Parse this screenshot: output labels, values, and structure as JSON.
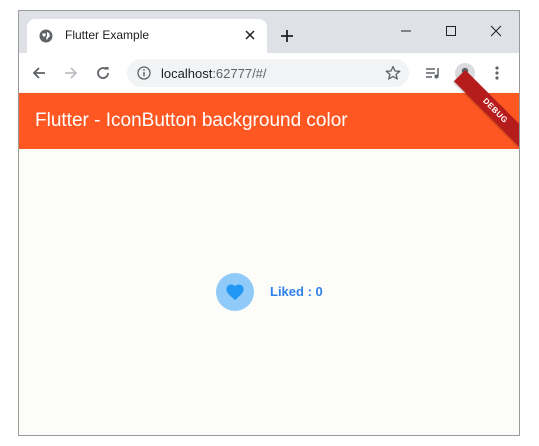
{
  "browser": {
    "tab_title": "Flutter Example",
    "url_host": "localhost",
    "url_rest": ":62777/#/"
  },
  "app": {
    "title": "Flutter - IconButton background color",
    "debug_label": "DEBUG",
    "like_text": "Liked : 0",
    "colors": {
      "appbar": "#ff5722",
      "button_bg": "#90caf9",
      "heart": "#2196f3",
      "like_text": "#2f80ed"
    }
  }
}
